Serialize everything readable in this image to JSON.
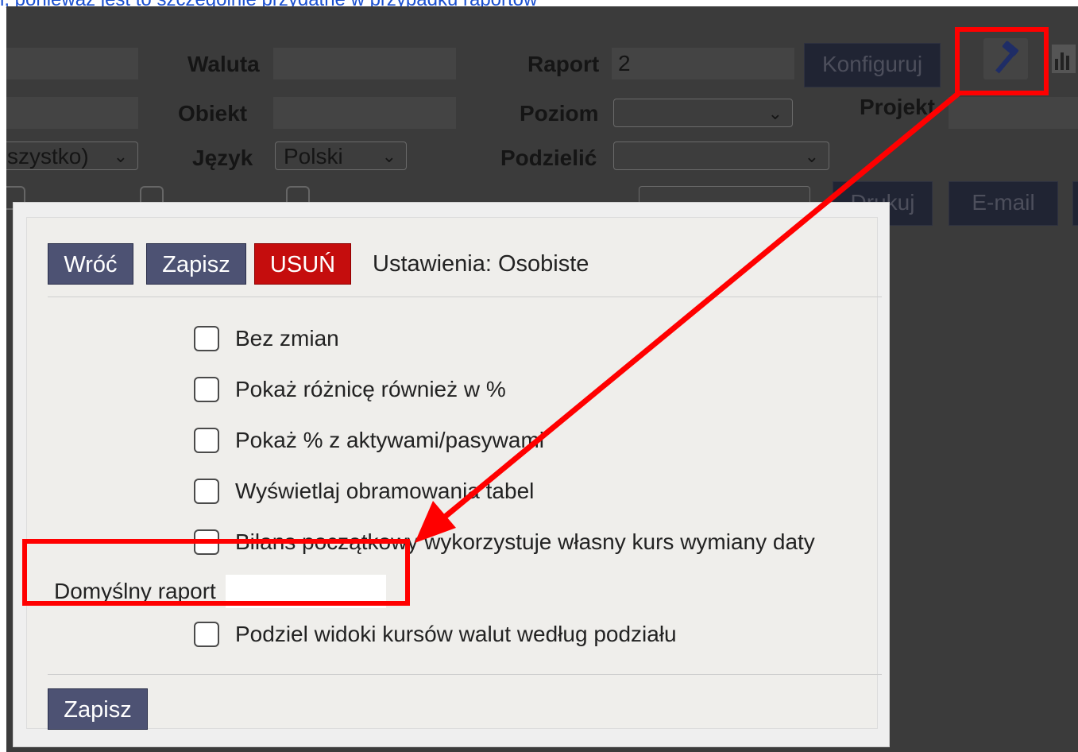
{
  "top_link": "i, ponieważ jest to szczególnie przydatne w przypadku raportów",
  "background": {
    "labels": {
      "waluta": "Waluta",
      "raport": "Raport",
      "obiekt": "Obiekt",
      "poziom": "Poziom",
      "projekt": "Projekt",
      "jezyk": "Język",
      "podzielic": "Podzielić"
    },
    "raport_value": "2",
    "jezyk_value": "Polski",
    "left_select_value": "szystko)",
    "konfiguruj_label": "Konfiguruj",
    "drukuj_label": "Drukuj",
    "email_label": "E-mail"
  },
  "dialog": {
    "back_label": "Wróć",
    "save_label": "Zapisz",
    "delete_label": "USUŃ",
    "settings_text": "Ustawienia: Osobiste",
    "options": [
      {
        "label": "Bez zmian",
        "checked": false
      },
      {
        "label": "Pokaż różnicę również w %",
        "checked": false
      },
      {
        "label": "Pokaż % z aktywami/pasywami",
        "checked": false
      },
      {
        "label": "Wyświetlaj obramowania tabel",
        "checked": false
      },
      {
        "label": "Bilans początkowy wykorzystuje własny kurs wymiany daty",
        "checked": false
      },
      {
        "label": "Podziel widoki kursów walut według podziału",
        "checked": false
      }
    ],
    "default_report_label": "Domyślny raport",
    "default_report_value": "",
    "footer_save_label": "Zapisz"
  },
  "colors": {
    "annotation": "#ff0000",
    "button_navy": "#4d5273",
    "button_red": "#c50d0d"
  },
  "icons": [
    "hammer-icon",
    "chart-icon",
    "chevron-down-icon",
    "checkbox-icon"
  ]
}
